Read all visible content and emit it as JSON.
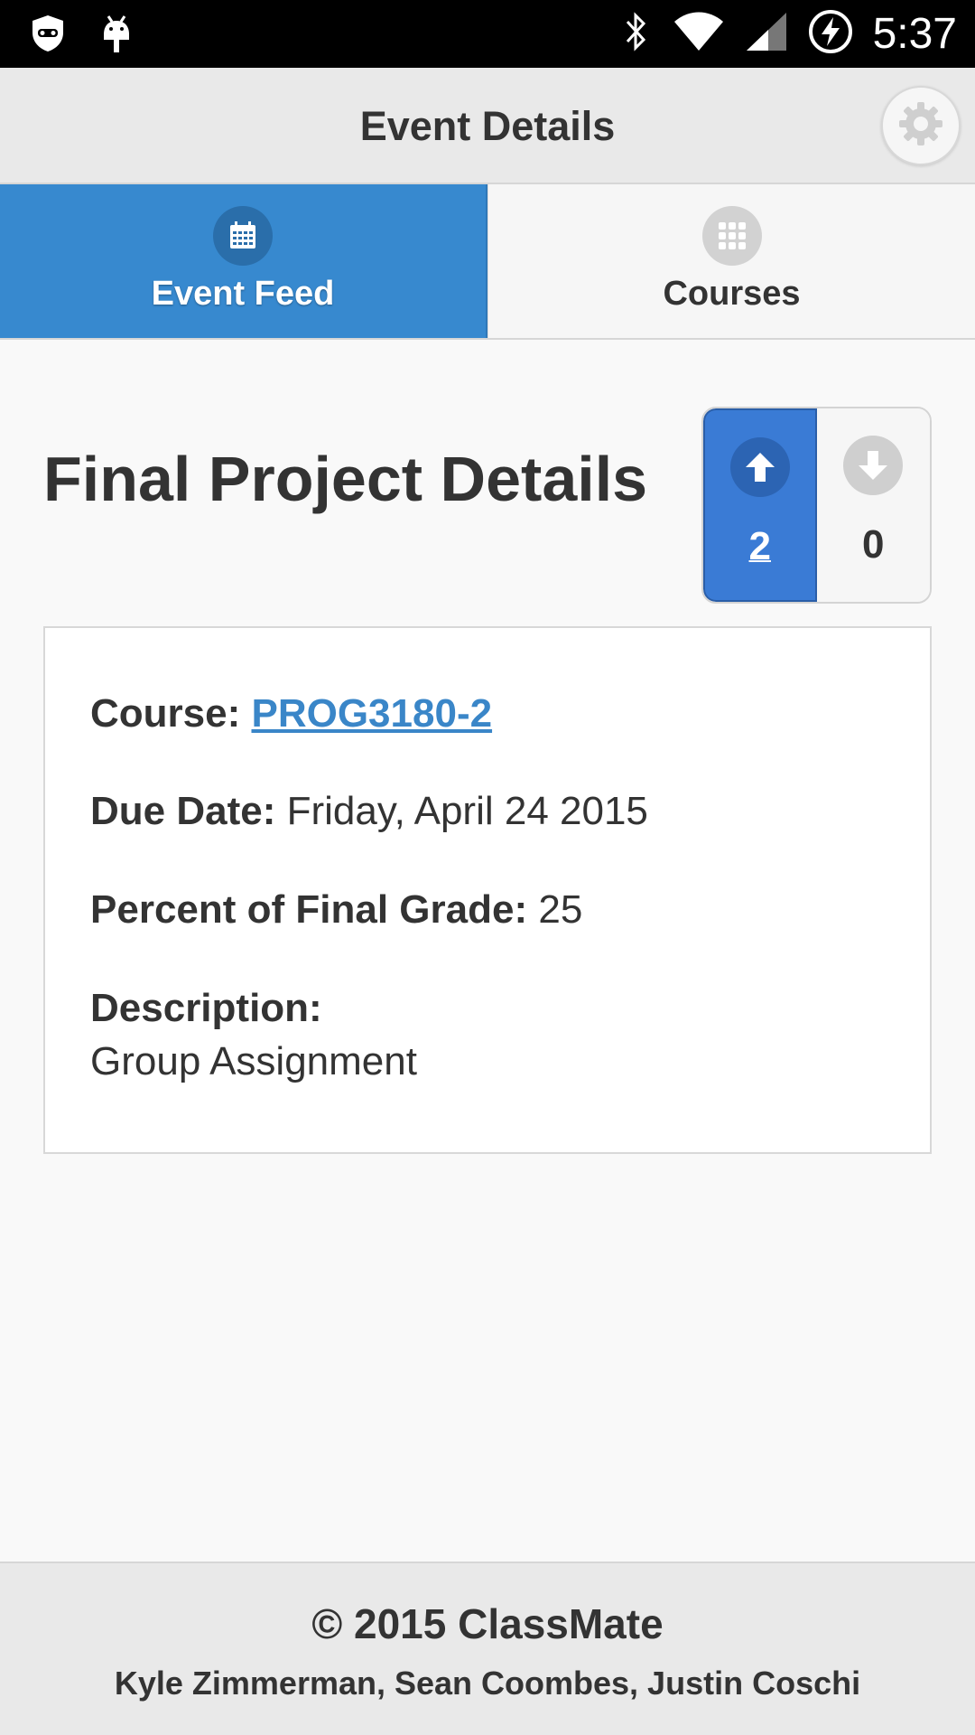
{
  "status_bar": {
    "time": "5:37",
    "icons": [
      "shield-icon",
      "android-icon",
      "bluetooth-icon",
      "wifi-icon",
      "signal-icon",
      "battery-charging-icon"
    ]
  },
  "header": {
    "title": "Event Details",
    "settings_icon": "gear-icon"
  },
  "tabs": [
    {
      "label": "Event Feed",
      "icon": "calendar-icon",
      "active": true
    },
    {
      "label": "Courses",
      "icon": "grid-icon",
      "active": false
    }
  ],
  "event": {
    "title": "Final Project Details",
    "votes": {
      "up": "2",
      "down": "0"
    },
    "course_label": "Course:",
    "course_value": "PROG3180-2",
    "due_label": "Due Date:",
    "due_value": "Friday, April 24 2015",
    "percent_label": "Percent of Final Grade:",
    "percent_value": "25",
    "description_label": "Description:",
    "description_value": "Group Assignment"
  },
  "footer": {
    "copyright": "© 2015 ClassMate",
    "authors": "Kyle Zimmerman, Sean Coombes, Justin Coschi"
  },
  "colors": {
    "accent": "#3789cf",
    "vote_up": "#3a7bd5",
    "link": "#3a86c8",
    "header_bg": "#e9e9e9"
  }
}
